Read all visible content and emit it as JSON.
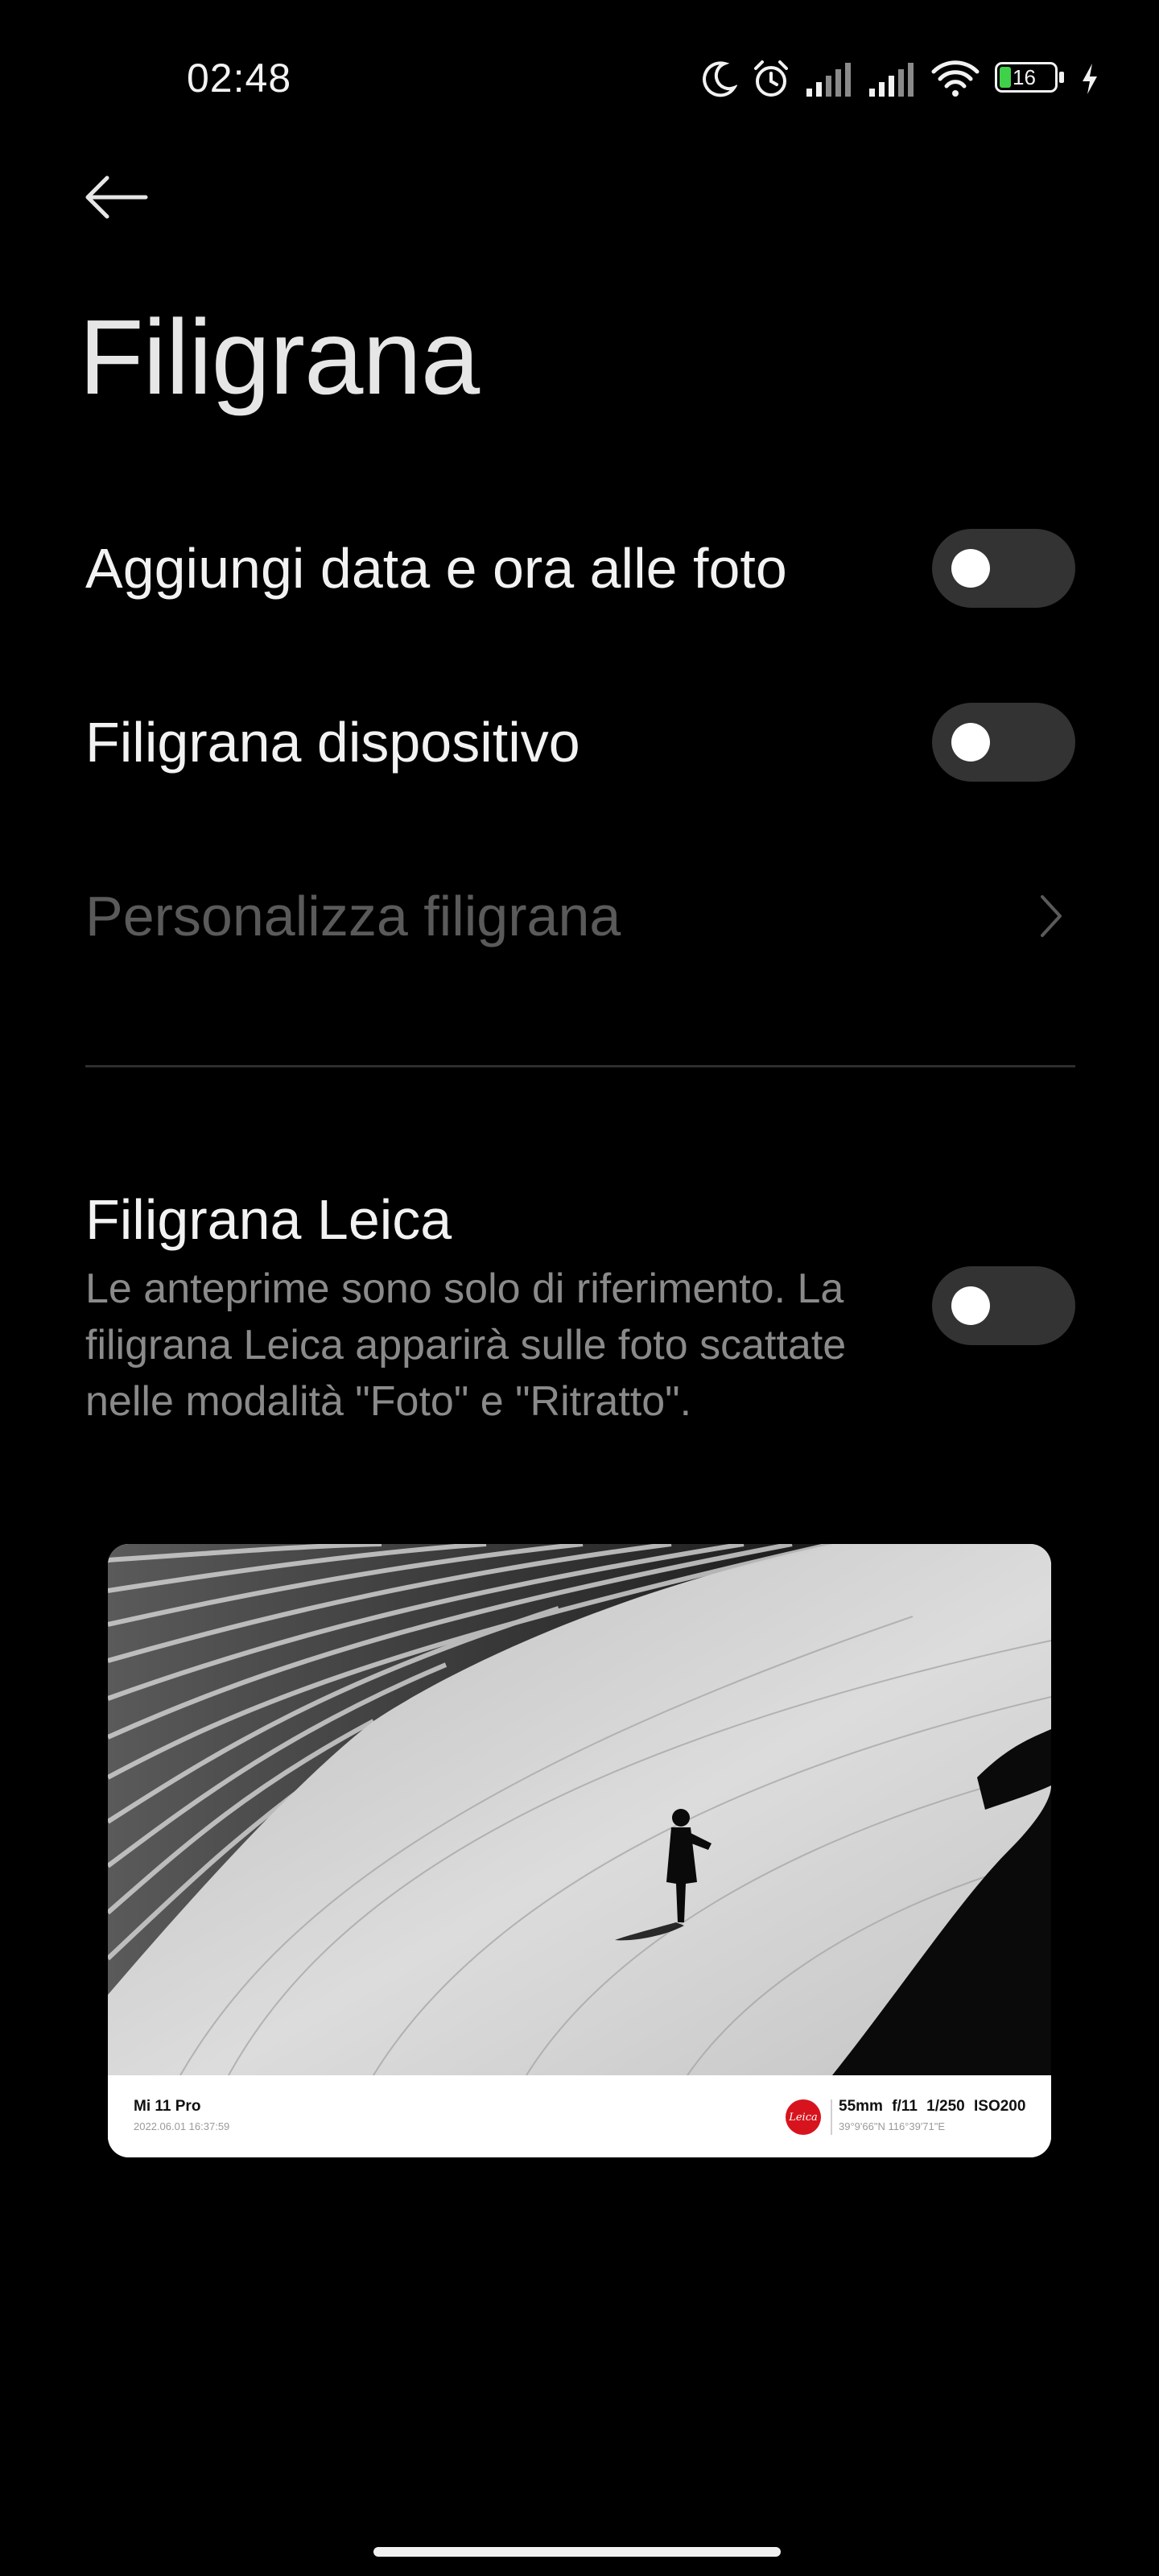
{
  "status_bar": {
    "time": "02:48",
    "battery_level": "16",
    "icons": [
      "moon-icon",
      "alarm-icon",
      "signal-icon",
      "signal-icon",
      "wifi-icon",
      "battery-icon",
      "charging-icon"
    ]
  },
  "header": {
    "title": "Filigrana"
  },
  "settings": {
    "datetime": {
      "label": "Aggiungi data e ora alle foto",
      "enabled": false
    },
    "device": {
      "label": "Filigrana dispositivo",
      "enabled": false
    },
    "customize": {
      "label": "Personalizza filigrana",
      "disabled": true
    }
  },
  "leica": {
    "title": "Filigrana Leica",
    "description": "Le anteprime sono solo di riferimento. La filigrana Leica apparirà sulle foto scattate nelle modalità \"Foto\" e \"Ritratto\".",
    "enabled": false
  },
  "preview": {
    "model": "Mi 11 Pro",
    "date": "2022.06.01 16:37:59",
    "logo_text": "Leica",
    "params": "55mm f/11 1/250 ISO200",
    "coords": "39°9'66\"N 116°39'71\"E"
  },
  "colors": {
    "background": "#000000",
    "toggle_off": "#333333",
    "text_primary": "#f2f2f2",
    "text_secondary": "#8a8a8a",
    "leica_red": "#d7141e"
  }
}
